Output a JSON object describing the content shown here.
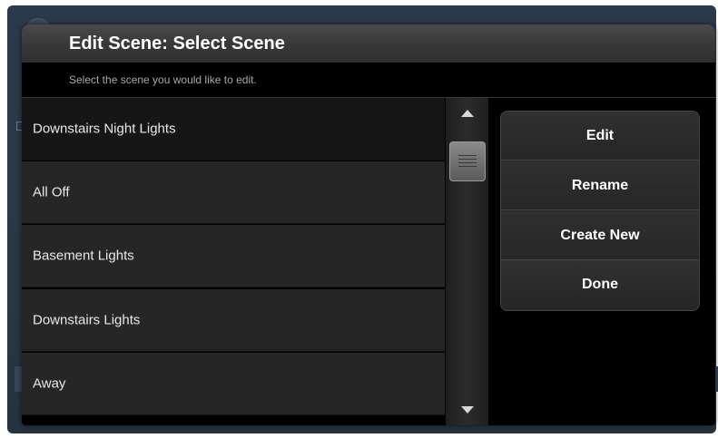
{
  "dialog": {
    "title": "Edit Scene: Select Scene",
    "subtitle": "Select the scene you would like to edit."
  },
  "scenes": [
    {
      "label": "Downstairs Night Lights",
      "selected": true
    },
    {
      "label": "All Off",
      "selected": false
    },
    {
      "label": "Basement Lights",
      "selected": false
    },
    {
      "label": "Downstairs Lights",
      "selected": false
    },
    {
      "label": "Away",
      "selected": false
    }
  ],
  "scrollbar": {
    "up_icon": "chevron-up-icon",
    "down_icon": "chevron-down-icon"
  },
  "actions": {
    "edit": "Edit",
    "rename": "Rename",
    "create_new": "Create New",
    "done": "Done"
  },
  "colors": {
    "dialog_background": "#000000",
    "list_item": "#262626",
    "selected_item": "#161616",
    "text": "#e8e8e8"
  }
}
